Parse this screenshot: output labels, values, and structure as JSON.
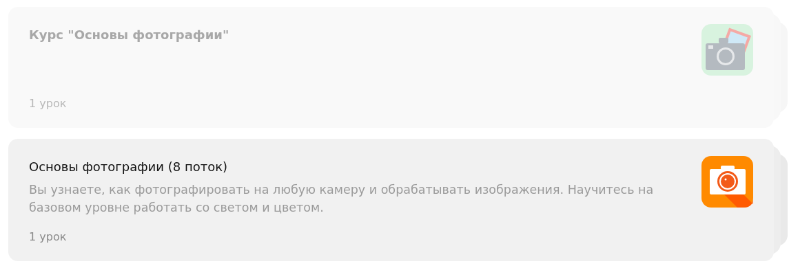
{
  "courses": [
    {
      "title": "Курс \"Основы фотографии\"",
      "lessons": "1 урок",
      "disabled": true,
      "icon": {
        "kind": "camera-photo"
      }
    },
    {
      "title": "Основы фотографии (8 поток)",
      "description": "Вы узнаете, как фотографировать на любую камеру и обрабатывать изображения. Научитесь на базовом уровне работать со светом и цветом.",
      "lessons": "1 урок",
      "disabled": false,
      "icon": {
        "kind": "camera-orange"
      }
    }
  ]
}
